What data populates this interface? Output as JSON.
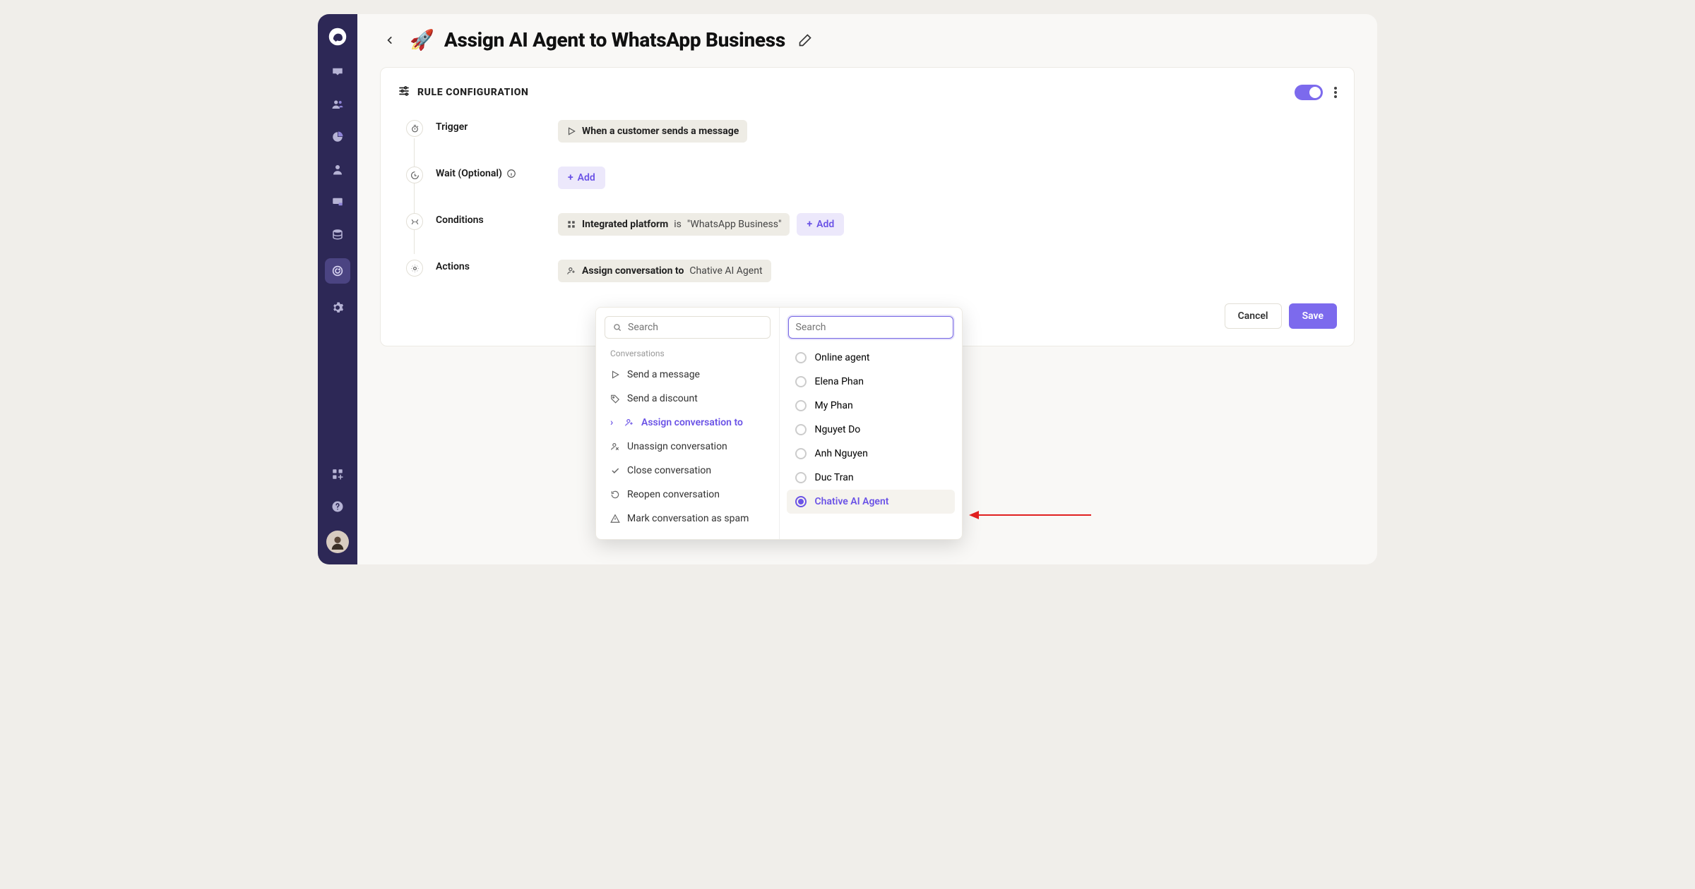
{
  "header": {
    "emoji": "🚀",
    "title": "Assign AI Agent to WhatsApp Business"
  },
  "card": {
    "title": "RULE CONFIGURATION",
    "toggle_on": true
  },
  "steps": {
    "trigger": {
      "label": "Trigger",
      "chip_prefix": "When a customer sends a message"
    },
    "wait": {
      "label": "Wait (Optional)",
      "add_label": "Add"
    },
    "conditions": {
      "label": "Conditions",
      "chip_strong": "Integrated platform",
      "chip_is": "is",
      "chip_value": "\"WhatsApp Business\"",
      "add_label": "Add"
    },
    "actions": {
      "label": "Actions",
      "chip_strong": "Assign conversation to",
      "chip_value": "Chative AI Agent"
    }
  },
  "footer": {
    "cancel": "Cancel",
    "save": "Save"
  },
  "popover": {
    "search_placeholder_left": "Search",
    "search_placeholder_right": "Search",
    "section_label": "Conversations",
    "actions": [
      {
        "icon": "send",
        "label": "Send a message"
      },
      {
        "icon": "tag",
        "label": "Send a discount"
      },
      {
        "icon": "assign",
        "label": "Assign conversation to",
        "selected": true
      },
      {
        "icon": "unassign",
        "label": "Unassign conversation"
      },
      {
        "icon": "check",
        "label": "Close conversation"
      },
      {
        "icon": "reopen",
        "label": "Reopen conversation"
      },
      {
        "icon": "spam",
        "label": "Mark conversation as spam"
      }
    ],
    "assignees": [
      {
        "label": "Online agent",
        "checked": false
      },
      {
        "label": "Elena Phan",
        "checked": false
      },
      {
        "label": "My Phan",
        "checked": false
      },
      {
        "label": "Nguyet Do",
        "checked": false
      },
      {
        "label": "Anh Nguyen",
        "checked": false
      },
      {
        "label": "Duc Tran",
        "checked": false
      },
      {
        "label": "Chative AI Agent",
        "checked": true
      }
    ]
  }
}
